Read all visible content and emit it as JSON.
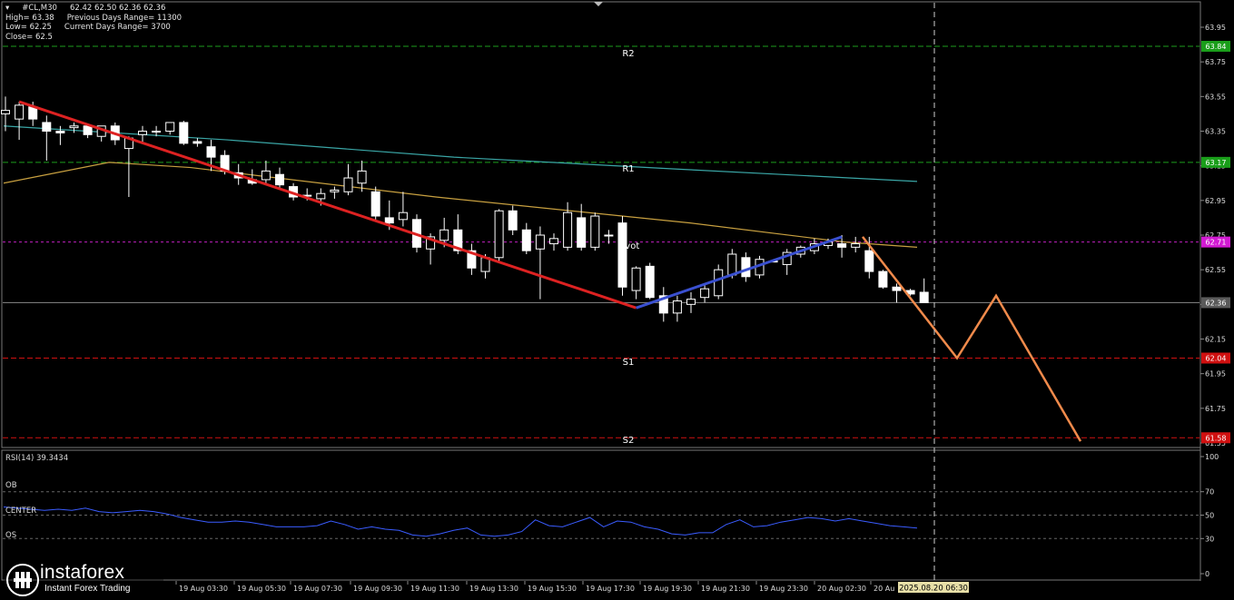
{
  "header": {
    "symbol": "#CL,M30",
    "ohlc": "62.42 62.50 62.36 62.36",
    "high_label": "High= 63.38",
    "low_label": "Low= 62.25",
    "close_label": "Close= 62.5",
    "prev_range": "Previous Days Range= 11300",
    "curr_range": "Current Days Range= 3700"
  },
  "levels": {
    "r2": "R2",
    "r1": "R1",
    "pivot": "Pivot",
    "s1": "S1",
    "s2": "S2"
  },
  "price_axis": {
    "ticks": [
      "63.95",
      "63.75",
      "63.55",
      "63.35",
      "63.15",
      "62.95",
      "62.75",
      "62.55",
      "62.35",
      "62.15",
      "61.95",
      "61.75",
      "61.55"
    ],
    "tags": [
      {
        "label": "63.84",
        "color": "#1a9e1a"
      },
      {
        "label": "63.17",
        "color": "#1a9e1a"
      },
      {
        "label": "62.71",
        "color": "#d21ad2"
      },
      {
        "label": "62.36",
        "color": "#5a5a5a"
      },
      {
        "label": "62.04",
        "color": "#d01010"
      },
      {
        "label": "61.58",
        "color": "#d01010"
      }
    ]
  },
  "rsi": {
    "label": "RSI(14) 39.3434",
    "ob": "OB",
    "center": "CENTER",
    "os": "OS",
    "ticks": [
      "100",
      "70",
      "50",
      "30",
      "0"
    ]
  },
  "time_axis": {
    "labels": [
      "19 Aug 03:30",
      "19 Aug 05:30",
      "19 Aug 07:30",
      "19 Aug 09:30",
      "19 Aug 11:30",
      "19 Aug 13:30",
      "19 Aug 15:30",
      "19 Aug 17:30",
      "19 Aug 19:30",
      "19 Aug 21:30",
      "19 Aug 23:30",
      "20 Aug 02:30",
      "20 Au"
    ],
    "cursor_time": "2025.08.20 06:30"
  },
  "watermark": {
    "brand": "instaforex",
    "tagline": "Instant Forex Trading"
  },
  "chart_data": {
    "type": "candlestick",
    "candles": [
      {
        "o": 63.45,
        "h": 63.55,
        "l": 63.35,
        "c": 63.47
      },
      {
        "o": 63.42,
        "h": 63.52,
        "l": 63.3,
        "c": 63.5
      },
      {
        "o": 63.49,
        "h": 63.52,
        "l": 63.38,
        "c": 63.42
      },
      {
        "o": 63.4,
        "h": 63.44,
        "l": 63.18,
        "c": 63.35
      },
      {
        "o": 63.35,
        "h": 63.38,
        "l": 63.27,
        "c": 63.34
      },
      {
        "o": 63.37,
        "h": 63.4,
        "l": 63.34,
        "c": 63.38
      },
      {
        "o": 63.38,
        "h": 63.39,
        "l": 63.31,
        "c": 63.33
      },
      {
        "o": 63.32,
        "h": 63.36,
        "l": 63.29,
        "c": 63.38
      },
      {
        "o": 63.38,
        "h": 63.4,
        "l": 63.27,
        "c": 63.3
      },
      {
        "o": 63.25,
        "h": 63.32,
        "l": 62.97,
        "c": 63.31
      },
      {
        "o": 63.33,
        "h": 63.38,
        "l": 63.28,
        "c": 63.35
      },
      {
        "o": 63.35,
        "h": 63.38,
        "l": 63.32,
        "c": 63.35
      },
      {
        "o": 63.35,
        "h": 63.4,
        "l": 63.33,
        "c": 63.4
      },
      {
        "o": 63.4,
        "h": 63.41,
        "l": 63.27,
        "c": 63.28
      },
      {
        "o": 63.29,
        "h": 63.31,
        "l": 63.26,
        "c": 63.28
      },
      {
        "o": 63.26,
        "h": 63.3,
        "l": 63.12,
        "c": 63.2
      },
      {
        "o": 63.21,
        "h": 63.24,
        "l": 63.1,
        "c": 63.12
      },
      {
        "o": 63.11,
        "h": 63.16,
        "l": 63.04,
        "c": 63.08
      },
      {
        "o": 63.07,
        "h": 63.13,
        "l": 63.04,
        "c": 63.05
      },
      {
        "o": 63.07,
        "h": 63.18,
        "l": 63.05,
        "c": 63.12
      },
      {
        "o": 63.1,
        "h": 63.14,
        "l": 63.02,
        "c": 63.04
      },
      {
        "o": 63.03,
        "h": 63.05,
        "l": 62.95,
        "c": 62.97
      },
      {
        "o": 62.98,
        "h": 63.02,
        "l": 62.95,
        "c": 62.98
      },
      {
        "o": 62.96,
        "h": 63.02,
        "l": 62.92,
        "c": 62.99
      },
      {
        "o": 63.0,
        "h": 63.03,
        "l": 62.96,
        "c": 63.01
      },
      {
        "o": 63.0,
        "h": 63.16,
        "l": 62.98,
        "c": 63.08
      },
      {
        "o": 63.05,
        "h": 63.18,
        "l": 63.0,
        "c": 63.12
      },
      {
        "o": 63.0,
        "h": 63.03,
        "l": 62.84,
        "c": 62.86
      },
      {
        "o": 62.85,
        "h": 62.95,
        "l": 62.78,
        "c": 62.82
      },
      {
        "o": 62.84,
        "h": 63.0,
        "l": 62.8,
        "c": 62.88
      },
      {
        "o": 62.84,
        "h": 62.87,
        "l": 62.65,
        "c": 62.68
      },
      {
        "o": 62.67,
        "h": 62.76,
        "l": 62.58,
        "c": 62.74
      },
      {
        "o": 62.72,
        "h": 62.85,
        "l": 62.68,
        "c": 62.78
      },
      {
        "o": 62.78,
        "h": 62.87,
        "l": 62.64,
        "c": 62.66
      },
      {
        "o": 62.66,
        "h": 62.7,
        "l": 62.52,
        "c": 62.56
      },
      {
        "o": 62.54,
        "h": 62.64,
        "l": 62.5,
        "c": 62.62
      },
      {
        "o": 62.62,
        "h": 62.9,
        "l": 62.6,
        "c": 62.89
      },
      {
        "o": 62.89,
        "h": 62.92,
        "l": 62.75,
        "c": 62.78
      },
      {
        "o": 62.78,
        "h": 62.82,
        "l": 62.64,
        "c": 62.66
      },
      {
        "o": 62.67,
        "h": 62.8,
        "l": 62.38,
        "c": 62.75
      },
      {
        "o": 62.7,
        "h": 62.76,
        "l": 62.66,
        "c": 62.73
      },
      {
        "o": 62.68,
        "h": 62.94,
        "l": 62.66,
        "c": 62.88
      },
      {
        "o": 62.85,
        "h": 62.93,
        "l": 62.66,
        "c": 62.68
      },
      {
        "o": 62.68,
        "h": 62.88,
        "l": 62.66,
        "c": 62.86
      },
      {
        "o": 62.75,
        "h": 62.78,
        "l": 62.7,
        "c": 62.75
      },
      {
        "o": 62.82,
        "h": 62.86,
        "l": 62.4,
        "c": 62.45
      },
      {
        "o": 62.43,
        "h": 62.57,
        "l": 62.38,
        "c": 62.56
      },
      {
        "o": 62.57,
        "h": 62.59,
        "l": 62.38,
        "c": 62.39
      },
      {
        "o": 62.4,
        "h": 62.45,
        "l": 62.25,
        "c": 62.3
      },
      {
        "o": 62.3,
        "h": 62.4,
        "l": 62.25,
        "c": 62.37
      },
      {
        "o": 62.35,
        "h": 62.42,
        "l": 62.3,
        "c": 62.38
      },
      {
        "o": 62.39,
        "h": 62.47,
        "l": 62.36,
        "c": 62.44
      },
      {
        "o": 62.4,
        "h": 62.58,
        "l": 62.38,
        "c": 62.55
      },
      {
        "o": 62.52,
        "h": 62.67,
        "l": 62.5,
        "c": 62.64
      },
      {
        "o": 62.62,
        "h": 62.65,
        "l": 62.48,
        "c": 62.51
      },
      {
        "o": 62.52,
        "h": 62.63,
        "l": 62.5,
        "c": 62.61
      },
      {
        "o": 62.6,
        "h": 62.61,
        "l": 62.6,
        "c": 62.6
      },
      {
        "o": 62.58,
        "h": 62.67,
        "l": 62.52,
        "c": 62.65
      },
      {
        "o": 62.64,
        "h": 62.69,
        "l": 62.62,
        "c": 62.68
      },
      {
        "o": 62.66,
        "h": 62.73,
        "l": 62.64,
        "c": 62.7
      },
      {
        "o": 62.69,
        "h": 62.73,
        "l": 62.67,
        "c": 62.71
      },
      {
        "o": 62.7,
        "h": 62.75,
        "l": 62.62,
        "c": 62.68
      },
      {
        "o": 62.68,
        "h": 62.74,
        "l": 62.65,
        "c": 62.7
      },
      {
        "o": 62.66,
        "h": 62.74,
        "l": 62.5,
        "c": 62.54
      },
      {
        "o": 62.54,
        "h": 62.55,
        "l": 62.44,
        "c": 62.45
      },
      {
        "o": 62.45,
        "h": 62.47,
        "l": 62.36,
        "c": 62.43
      },
      {
        "o": 62.43,
        "h": 62.44,
        "l": 62.4,
        "c": 62.41
      },
      {
        "o": 62.42,
        "h": 62.5,
        "l": 62.36,
        "c": 62.36
      }
    ],
    "ma_long": [
      63.38,
      63.3,
      63.2,
      63.13,
      63.06
    ],
    "ma_short": [
      63.05,
      63.17,
      63.14,
      62.97,
      62.82,
      62.71,
      62.68
    ],
    "levels": {
      "R2": 63.84,
      "R1": 63.17,
      "Pivot": 62.71,
      "S1": 62.04,
      "S2": 61.58,
      "current": 62.36
    },
    "trendlines": [
      {
        "color": "#dd2222",
        "from": {
          "i": 1,
          "p": 63.52
        },
        "to": {
          "i": 46,
          "p": 62.33
        }
      },
      {
        "color": "#3a50d0",
        "from": {
          "i": 46,
          "p": 62.33
        },
        "to": {
          "i": 61,
          "p": 62.74
        }
      }
    ],
    "forecast": [
      62.74,
      62.04,
      62.4,
      61.56
    ],
    "rsi_values": [
      57,
      56,
      55,
      54,
      55,
      54,
      56,
      53,
      52,
      53,
      54,
      53,
      51,
      48,
      46,
      44,
      44,
      45,
      44,
      42,
      40,
      40,
      40,
      41,
      45,
      42,
      38,
      40,
      38,
      37,
      33,
      32,
      34,
      37,
      39,
      33,
      32,
      33,
      36,
      46,
      41,
      40,
      44,
      48,
      40,
      45,
      44,
      40,
      38,
      34,
      33,
      35,
      35,
      42,
      46,
      40,
      41,
      44,
      46,
      48,
      47,
      45,
      47,
      45,
      43,
      41,
      40,
      39
    ]
  }
}
